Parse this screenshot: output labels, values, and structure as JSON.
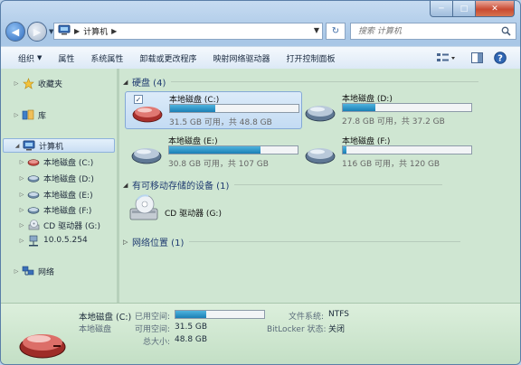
{
  "window": {
    "min_glyph": "─",
    "max_glyph": "□",
    "close_glyph": "✕"
  },
  "address": {
    "crumbs": [
      "计算机"
    ],
    "refresh_glyph": "↻"
  },
  "search": {
    "placeholder": "搜索 计算机"
  },
  "toolbar": {
    "organize": "组织",
    "properties": "属性",
    "system_properties": "系统属性",
    "uninstall": "卸载或更改程序",
    "map_drive": "映射网络驱动器",
    "control_panel": "打开控制面板"
  },
  "nav": {
    "favorites": "收藏夹",
    "libraries": "库",
    "computer": "计算机",
    "drives": [
      {
        "label": "本地磁盘 (C:)"
      },
      {
        "label": "本地磁盘 (D:)"
      },
      {
        "label": "本地磁盘 (E:)"
      },
      {
        "label": "本地磁盘 (F:)"
      },
      {
        "label": "CD 驱动器 (G:)"
      },
      {
        "label": "10.0.5.254"
      }
    ],
    "network": "网络"
  },
  "groups": {
    "hdd": "硬盘 (4)",
    "removable": "有可移动存储的设备 (1)",
    "netloc": "网络位置 (1)"
  },
  "disks": [
    {
      "name": "本地磁盘 (C:)",
      "free": "31.5 GB 可用，共 48.8 GB",
      "used_fraction": 0.35,
      "checked": "✓"
    },
    {
      "name": "本地磁盘 (D:)",
      "free": "27.8 GB 可用，共 37.2 GB",
      "used_fraction": 0.25
    },
    {
      "name": "本地磁盘 (E:)",
      "free": "30.8 GB 可用，共 107 GB",
      "used_fraction": 0.71
    },
    {
      "name": "本地磁盘 (F:)",
      "free": "116 GB 可用，共 120 GB",
      "used_fraction": 0.03
    }
  ],
  "cd": {
    "name": "CD 驱动器 (G:)"
  },
  "details": {
    "name": "本地磁盘 (C:)",
    "type": "本地磁盘",
    "used_label": "已用空间:",
    "used_fraction": 0.35,
    "avail_label": "可用空间:",
    "avail_value": "31.5 GB",
    "total_label": "总大小:",
    "total_value": "48.8 GB",
    "fs_label": "文件系统:",
    "fs_value": "NTFS",
    "bitlocker_label": "BitLocker 状态:",
    "bitlocker_value": "关闭"
  }
}
